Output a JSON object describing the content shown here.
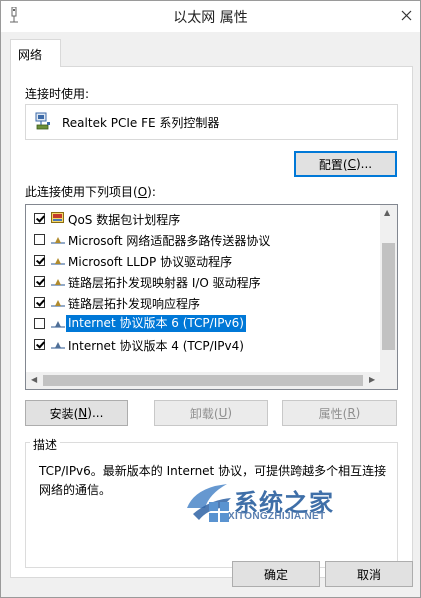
{
  "window": {
    "title": "以太网 属性"
  },
  "tabs": [
    {
      "label": "网络"
    }
  ],
  "connect_using": {
    "label": "连接时使用:",
    "adapter_name": "Realtek PCIe FE 系列控制器"
  },
  "buttons": {
    "configure": {
      "label": "配置(",
      "accel": "C",
      "after": ")..."
    },
    "install": {
      "label": "安装(",
      "accel": "N",
      "after": ")..."
    },
    "uninstall": {
      "label": "卸载(",
      "accel": "U",
      "after": ")"
    },
    "properties": {
      "label": "属性(",
      "accel": "R",
      "after": ")"
    },
    "ok": {
      "label": "确定"
    },
    "cancel": {
      "label": "取消"
    }
  },
  "items_section": {
    "label": "此连接使用下列项目(",
    "accel": "O",
    "after": "):"
  },
  "items": [
    {
      "label": "QoS 数据包计划程序",
      "checked": true,
      "icon": "qos-icon"
    },
    {
      "label": "Microsoft 网络适配器多路传送器协议",
      "checked": false,
      "icon": "protocol-icon"
    },
    {
      "label": "Microsoft LLDP 协议驱动程序",
      "checked": true,
      "icon": "protocol-icon"
    },
    {
      "label": "链路层拓扑发现映射器 I/O 驱动程序",
      "checked": true,
      "icon": "protocol-icon"
    },
    {
      "label": "链路层拓扑发现响应程序",
      "checked": true,
      "icon": "protocol-icon"
    },
    {
      "label": "Internet 协议版本 6 (TCP/IPv6)",
      "checked": false,
      "icon": "protocol-icon",
      "selected": true
    },
    {
      "label": "Internet 协议版本 4 (TCP/IPv4)",
      "checked": true,
      "icon": "protocol-icon"
    }
  ],
  "description": {
    "title": "描述",
    "text": "TCP/IPv6。最新版本的 Internet 协议，可提供跨越多个相互连接网络的通信。"
  },
  "watermark": {
    "text": "系统之家",
    "subtext": "XITONGZHIJIA.NET"
  },
  "colors": {
    "selection": "#0078d7",
    "watermark": "#3f6fa8"
  }
}
